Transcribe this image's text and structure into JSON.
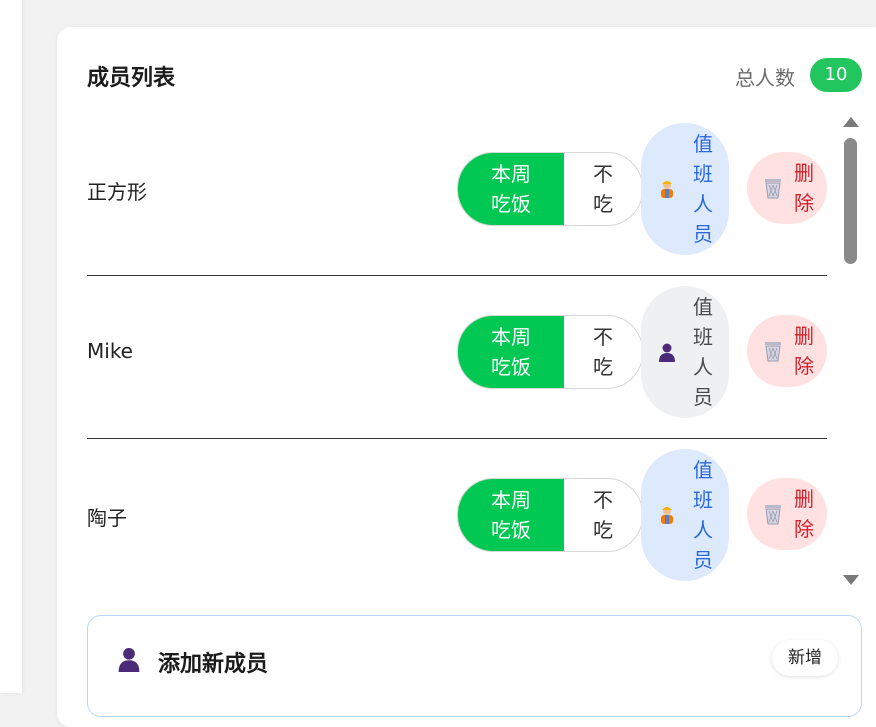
{
  "panel": {
    "title": "成员列表",
    "total_label": "总人数",
    "total_count": "10"
  },
  "members": [
    {
      "name": "正方形",
      "toggle_on": [
        "本周",
        "吃饭"
      ],
      "toggle_off": [
        "不",
        "吃"
      ],
      "duty_label": [
        "值",
        "班",
        "人",
        "员"
      ],
      "duty_active": true,
      "duty_icon": "construction-worker-icon",
      "delete_label": [
        "删",
        "除"
      ]
    },
    {
      "name": "Mike",
      "toggle_on": [
        "本周",
        "吃饭"
      ],
      "toggle_off": [
        "不",
        "吃"
      ],
      "duty_label": [
        "值",
        "班",
        "人",
        "员"
      ],
      "duty_active": false,
      "duty_icon": "person-icon",
      "delete_label": [
        "删",
        "除"
      ]
    },
    {
      "name": "陶子",
      "toggle_on": [
        "本周",
        "吃饭"
      ],
      "toggle_off": [
        "不",
        "吃"
      ],
      "duty_label": [
        "值",
        "班",
        "人",
        "员"
      ],
      "duty_active": true,
      "duty_icon": "construction-worker-icon",
      "delete_label": [
        "删",
        "除"
      ]
    }
  ],
  "add_member": {
    "title": "添加新成员",
    "button_label": "新增",
    "icon": "person-icon"
  },
  "colors": {
    "accent_green": "#00c853",
    "badge_green": "#22c55e",
    "duty_active_bg": "#dde9fd",
    "duty_active_text": "#2a6ad8",
    "delete_bg": "#ffe1e1",
    "delete_text": "#d3222a"
  }
}
